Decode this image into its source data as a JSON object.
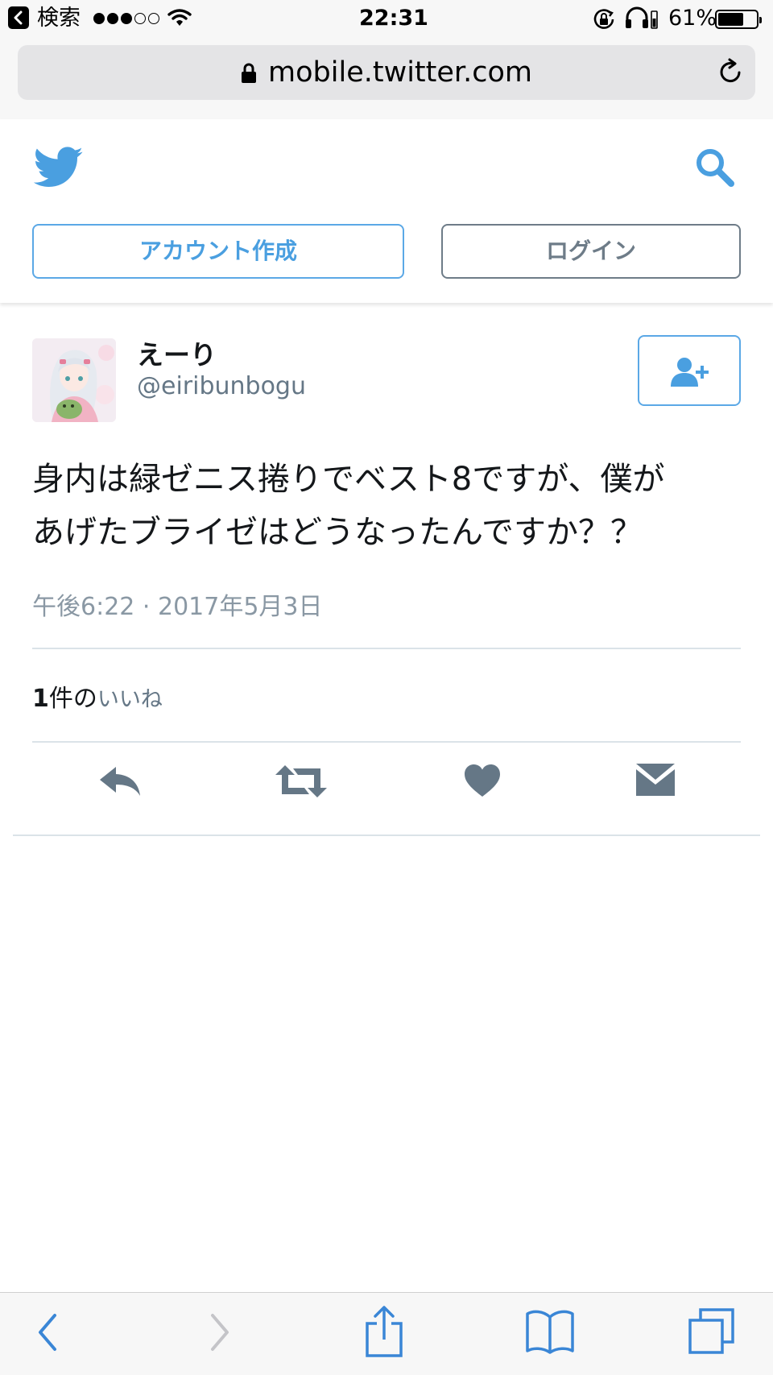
{
  "status_bar": {
    "back_label": "検索",
    "time": "22:31",
    "battery": "61%",
    "battery_level": 0.61,
    "signal_filled": 3,
    "signal_total": 5
  },
  "browser": {
    "url": "mobile.twitter.com"
  },
  "header": {
    "signup_label": "アカウント作成",
    "login_label": "ログイン"
  },
  "tweet": {
    "display_name": "えーり",
    "handle": "@eiribunbogu",
    "text_line1": "身内は緑ゼニス捲りでベスト8ですが、僕が",
    "text_line2": "あげたブライゼはどうなったんですか？？",
    "timestamp": "午後6:22 · 2017年5月3日",
    "like_count": "1",
    "like_count_suffix": "件の",
    "like_label": "いいね"
  },
  "colors": {
    "twitter_blue": "#5ba8e6",
    "icon_gray": "#657786",
    "browser_blue": "#3a86d6"
  },
  "icons": {
    "logo": "twitter-bird-icon",
    "search": "search-icon",
    "follow": "add-user-icon",
    "reply": "reply-icon",
    "retweet": "retweet-icon",
    "like": "heart-icon",
    "dm": "envelope-icon"
  }
}
